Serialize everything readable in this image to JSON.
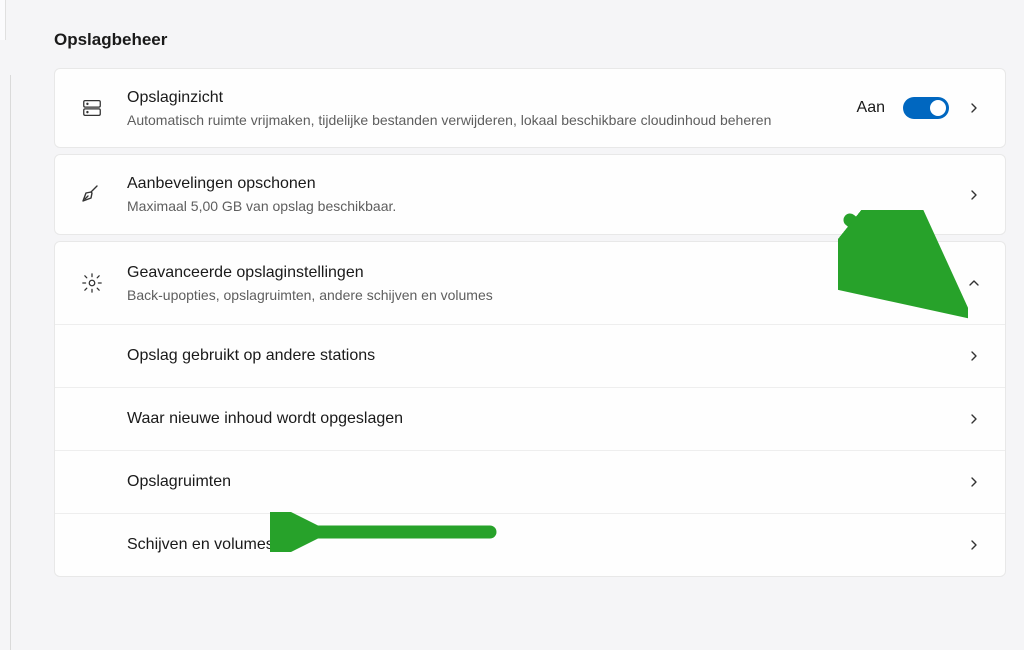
{
  "section_title": "Opslagbeheer",
  "cards": {
    "insight": {
      "title": "Opslaginzicht",
      "subtitle": "Automatisch ruimte vrijmaken, tijdelijke bestanden verwijderen, lokaal beschikbare cloudinhoud beheren",
      "toggle_label": "Aan",
      "toggle_on": true
    },
    "recommend": {
      "title": "Aanbevelingen opschonen",
      "subtitle": "Maximaal 5,00 GB van opslag beschikbaar."
    },
    "advanced": {
      "title": "Geavanceerde opslaginstellingen",
      "subtitle": "Back-upopties, opslagruimten, andere schijven en volumes",
      "rows": [
        {
          "label": "Opslag gebruikt op andere stations"
        },
        {
          "label": "Waar nieuwe inhoud wordt opgeslagen"
        },
        {
          "label": "Opslagruimten"
        },
        {
          "label": "Schijven en volumes"
        }
      ]
    }
  },
  "annotation_color": "#27a22a"
}
